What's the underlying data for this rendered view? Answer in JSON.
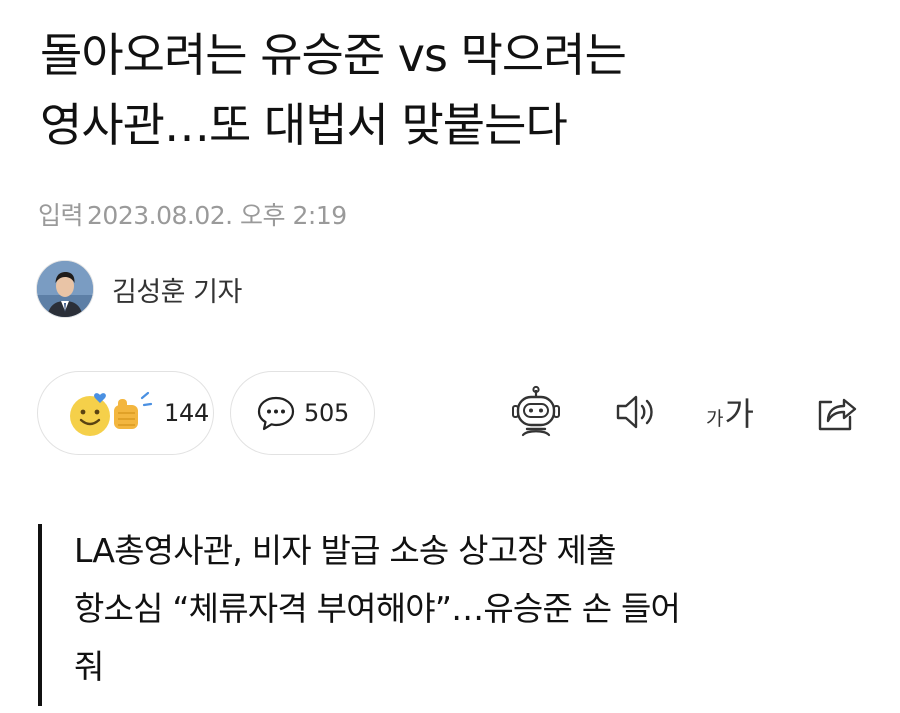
{
  "article": {
    "headline_line1": "돌아오려는 유승준 vs 막으려는",
    "headline_line2": "영사관…또 대법서 맞붙는다",
    "date_label": "입력",
    "date_value": "2023.08.02. 오후 2:19",
    "author_name": "김성훈 기자",
    "subhead_line1": "LA총영사관, 비자 발급 소송 상고장 제출",
    "subhead_line2": "항소심 “체류자격 부여해야”…유승준 손 들어",
    "subhead_line3": "줘"
  },
  "actions": {
    "reaction_count": "144",
    "comment_count": "505",
    "font_size_small": "가",
    "font_size_large": "가"
  },
  "icons": {
    "reaction": "reaction-emoji-icon",
    "comment": "comment-bubble-icon",
    "summary_bot": "robot-icon",
    "read_aloud": "speaker-icon",
    "font_size": "font-size-icon",
    "share": "share-icon"
  },
  "colors": {
    "text": "#111111",
    "meta": "#9a9a9a",
    "border": "#e2e2e2",
    "emoji_yellow": "#f5d04a",
    "heart_blue": "#4a90e2"
  }
}
